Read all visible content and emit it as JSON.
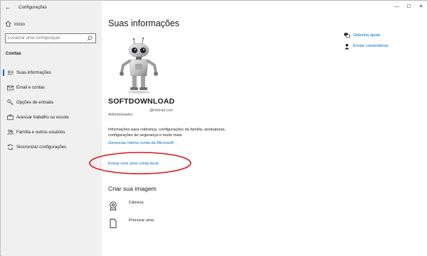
{
  "window": {
    "title": "Configurações",
    "controls": {
      "minimize": "—",
      "maximize": "☐",
      "close": "✕"
    },
    "back_icon": "←"
  },
  "sidebar": {
    "home_label": "Início",
    "search_placeholder": "Localizar uma configuração",
    "section": "Contas",
    "items": [
      {
        "label": "Suas informações",
        "icon": "person-card-icon",
        "active": true
      },
      {
        "label": "Email e contas",
        "icon": "mail-icon",
        "active": false
      },
      {
        "label": "Opções de entrada",
        "icon": "key-icon",
        "active": false
      },
      {
        "label": "Acessar trabalho ou escola",
        "icon": "briefcase-icon",
        "active": false
      },
      {
        "label": "Família e outros usuários",
        "icon": "people-icon",
        "active": false
      },
      {
        "label": "Sincronizar configurações",
        "icon": "sync-icon",
        "active": false
      }
    ]
  },
  "main": {
    "title": "Suas informações",
    "user": {
      "name": "SOFTDOWNLOAD",
      "email_suffix": "@hotmail.com",
      "role": "Administrador"
    },
    "info_text": "Informações para cobrança, configurações da família, assinaturas, configurações de segurança e muito mais",
    "manage_link": "Gerenciar minha conta da Microsoft",
    "local_link": "Entrar com uma conta local",
    "create_title": "Criar sua imagem",
    "create_options": [
      {
        "label": "Câmera",
        "icon": "camera-icon"
      },
      {
        "label": "Procurar uma",
        "icon": "browse-file-icon"
      }
    ]
  },
  "help": {
    "get_help": "Obtenha ajuda",
    "feedback": "Enviar comentários"
  },
  "colors": {
    "accent": "#0067c0",
    "annotation": "#e0141a",
    "sidebar_bg": "#f0f0f0",
    "main_bg": "#ffffff"
  }
}
